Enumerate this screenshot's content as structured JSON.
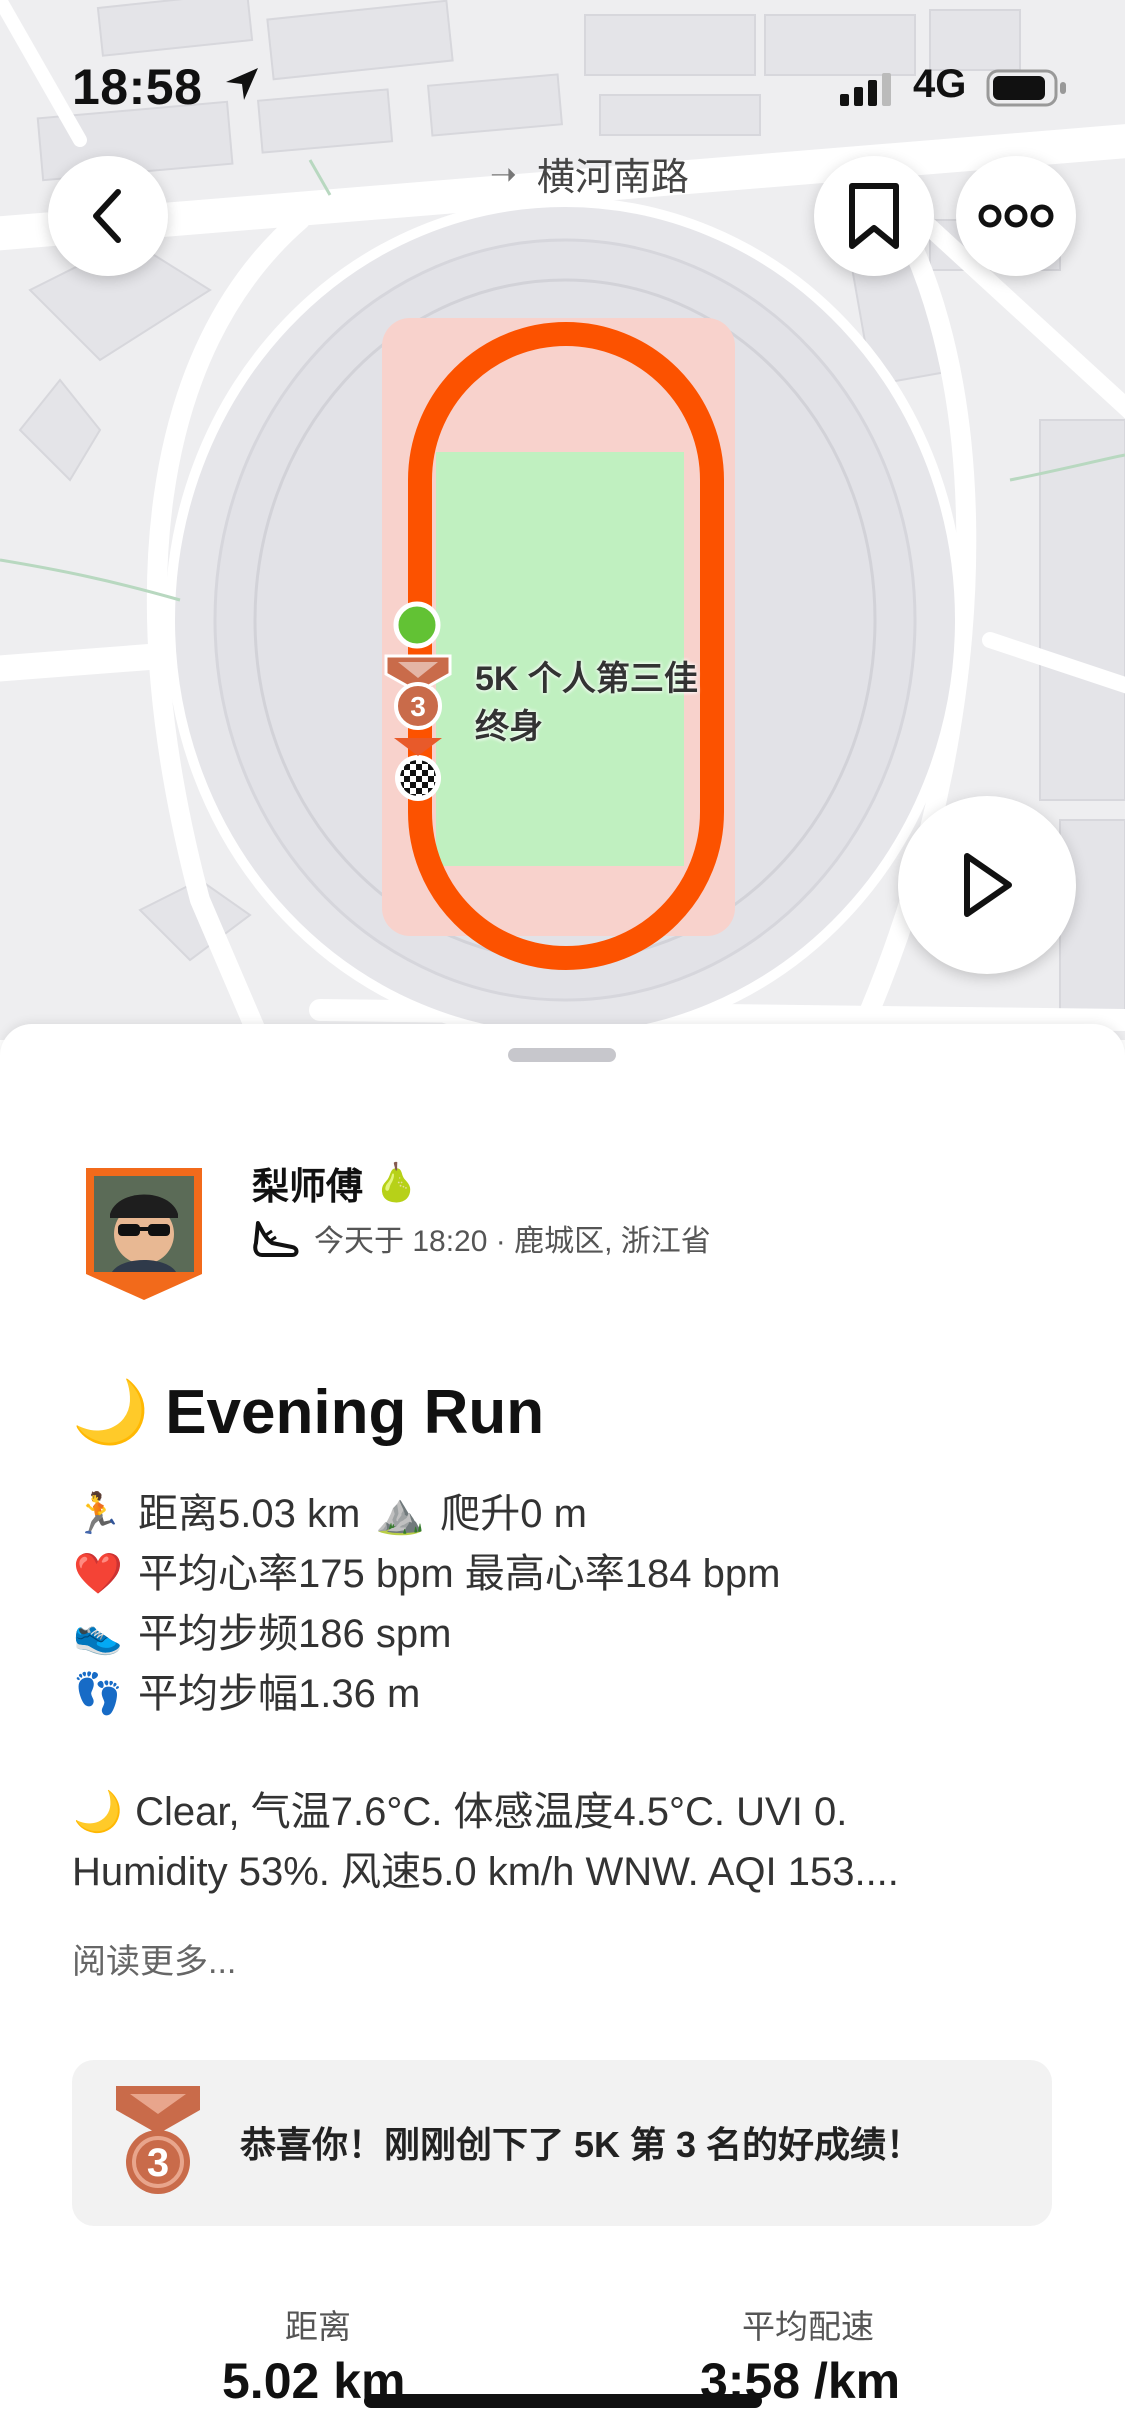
{
  "status_bar": {
    "time": "18:58",
    "network": "4G"
  },
  "map": {
    "road_label": "横河南路",
    "pb_line1": "5K 个人第三佳",
    "pb_line2": "终身",
    "medal_rank": "3"
  },
  "user": {
    "name": "梨师傅",
    "name_emoji": "🍐",
    "meta": "今天于 18:20 · 鹿城区, 浙江省"
  },
  "activity": {
    "title_emoji": "🌙",
    "title": "Evening Run",
    "stats": [
      {
        "emoji": "🏃",
        "text": "距离5.03 km",
        "extra_emoji": "⛰️",
        "extra_text": "爬升0 m"
      },
      {
        "emoji": "❤️",
        "text": "平均心率175 bpm 最高心率184 bpm"
      },
      {
        "emoji": "👟",
        "text": "平均步频186 spm"
      },
      {
        "emoji": "👣",
        "text": "平均步幅1.36 m"
      }
    ],
    "weather_emoji": "🌙",
    "weather_line1": "Clear, 气温7.6°C. 体感温度4.5°C. UVI 0.",
    "weather_line2": "Humidity 53%. 风速5.0 km/h WNW. AQI 153....",
    "read_more": "阅读更多..."
  },
  "pb_card": {
    "medal_rank": "3",
    "text": "恭喜你！刚刚创下了 5K 第 3 名的好成绩！"
  },
  "summary": {
    "distance_label": "距离",
    "distance_value": "5.02 km",
    "pace_label": "平均配速",
    "pace_value": "3:58 /km"
  },
  "colors": {
    "route": "#fc5200",
    "track": "#f8d2cc",
    "field": "#c0f0c0",
    "start": "#62c234",
    "medal": "#c96b4a"
  }
}
